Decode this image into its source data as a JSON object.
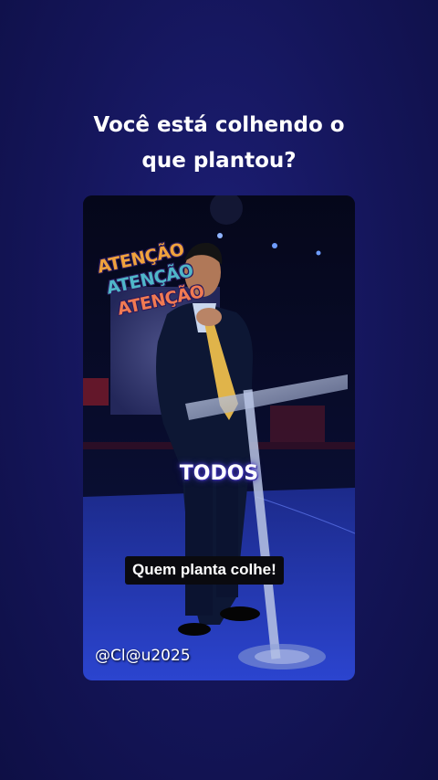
{
  "headline": {
    "line1": "Você está colhendo o",
    "line2": "que plantou?"
  },
  "video": {
    "overlay_words": [
      "ATENÇÃO",
      "ATENÇÃO",
      "ATENÇÃO"
    ],
    "overlay_colors": [
      "#f0a23c",
      "#4fb6c9",
      "#f07a52"
    ],
    "emphasis_word": "TODOS",
    "caption": "Quem planta colhe!",
    "watermark": "@Cl@u2025"
  },
  "colors": {
    "background": "#141559",
    "stage_blue": "#2a3fc4",
    "tie": "#e0b44a"
  }
}
